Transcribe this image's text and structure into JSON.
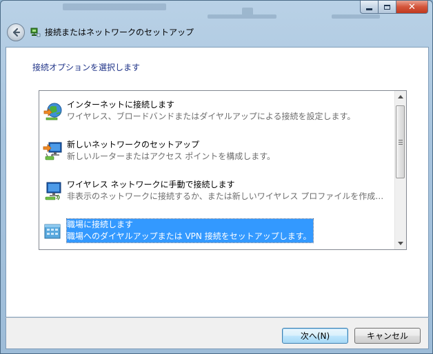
{
  "window": {
    "title": "接続またはネットワークのセットアップ",
    "close_glyph": "✕"
  },
  "main": {
    "instruction": "接続オプションを選択します"
  },
  "options": [
    {
      "title": "インターネットに接続します",
      "description": "ワイヤレス、ブロードバンドまたはダイヤルアップによる接続を設定します。",
      "icon": "internet-globe-icon",
      "selected": false
    },
    {
      "title": "新しいネットワークのセットアップ",
      "description": "新しいルーターまたはアクセス ポイントを構成します。",
      "icon": "router-setup-icon",
      "selected": false
    },
    {
      "title": "ワイヤレス ネットワークに手動で接続します",
      "description": "非表示のネットワークに接続するか、または新しいワイヤレス プロファイルを作成…",
      "icon": "wireless-monitor-icon",
      "selected": false
    },
    {
      "title": "職場に接続します",
      "description": "職場へのダイヤルアップまたは VPN 接続をセットアップします。",
      "icon": "workplace-vpn-icon",
      "selected": true
    }
  ],
  "footer": {
    "next_label": "次へ(N)",
    "cancel_label": "キャンセル"
  },
  "colors": {
    "instruction_text": "#1e3287",
    "selection": "#3399ff"
  }
}
